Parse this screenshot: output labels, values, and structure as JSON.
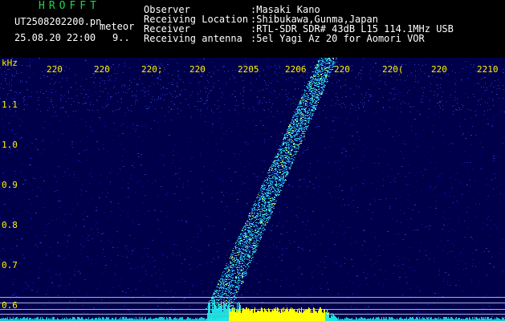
{
  "header": {
    "logo": "HROFFT",
    "filename": "UT2508202200.pn",
    "tag": "meteor",
    "date": "25.08.20 22:00",
    "count": "9..",
    "info": [
      {
        "label": "Observer",
        "value": ":Masaki Kano"
      },
      {
        "label": "Receiving Location",
        "value": ":Shibukawa,Gunma,Japan"
      },
      {
        "label": "Receiver",
        "value": ":RTL-SDR SDR# 43dB L15 114.1MHz USB"
      },
      {
        "label": "Receiving antenna",
        "value": ":5el Yagi Az 20 for Aomori VOR"
      }
    ]
  },
  "spectrogram": {
    "y_unit": "kHz",
    "y_ticks": [
      "1.1",
      "1.0",
      "0.9",
      "0.8",
      "0.7",
      "0.6"
    ],
    "x_ticks": [
      "220",
      "220",
      "220;",
      "220",
      "2205",
      "2206",
      "220",
      "220(",
      "220",
      "2210"
    ],
    "colors": {
      "background": "#000060",
      "signal": "#22e6e6",
      "peak": "#ffff00",
      "text": "#fff200"
    }
  }
}
